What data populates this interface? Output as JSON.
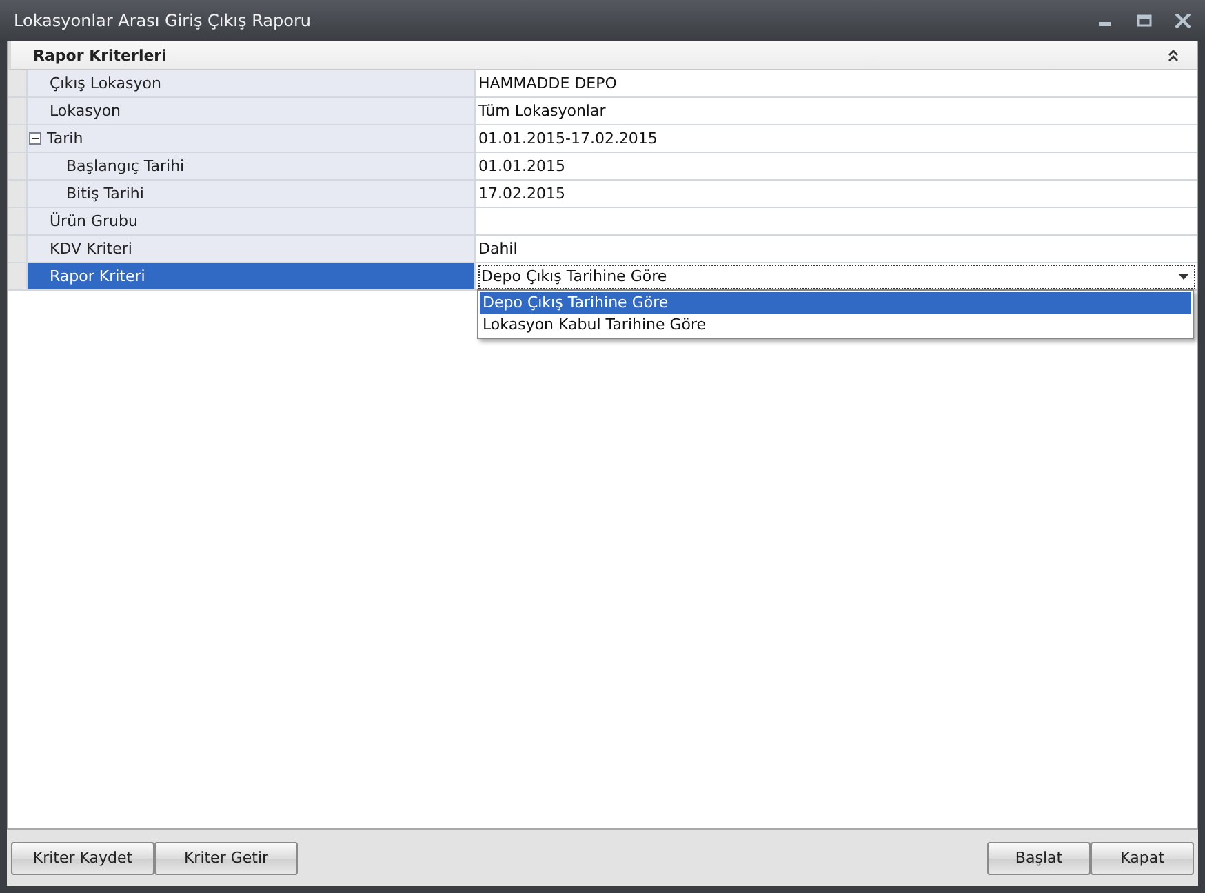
{
  "window": {
    "title": "Lokasyonlar Arası Giriş Çıkış Raporu"
  },
  "panel": {
    "title": "Rapor Kriterleri",
    "expanded": true,
    "rows": [
      {
        "label": "Çıkış Lokasyon",
        "value": "HAMMADDE DEPO",
        "selected": false
      },
      {
        "label": "Lokasyon",
        "value": "Tüm Lokasyonlar",
        "selected": false
      },
      {
        "label": "Tarih",
        "value": "01.01.2015-17.02.2015",
        "selected": false,
        "expanded": true,
        "children": [
          {
            "label": "Başlangıç Tarihi",
            "value": "01.01.2015",
            "selected": false
          },
          {
            "label": "Bitiş Tarihi",
            "value": "17.02.2015",
            "selected": false
          }
        ]
      },
      {
        "label": "Ürün Grubu",
        "selected": false
      },
      {
        "label": "KDV Kriteri",
        "value": "Dahil",
        "selected": false
      },
      {
        "label": "Rapor Kriteri",
        "value": "Depo Çıkış Tarihine Göre",
        "selected": true,
        "kind": "dropdown"
      }
    ],
    "dropdown": {
      "options": [
        {
          "label": "Depo Çıkış Tarihine Göre",
          "selected": true
        },
        {
          "label": "Lokasyon Kabul Tarihine Göre",
          "selected": false
        }
      ]
    }
  },
  "buttons_left": [
    "Kriter Kaydet",
    "Kriter Getir"
  ],
  "buttons_right": [
    "Başlat",
    "Kapat"
  ]
}
